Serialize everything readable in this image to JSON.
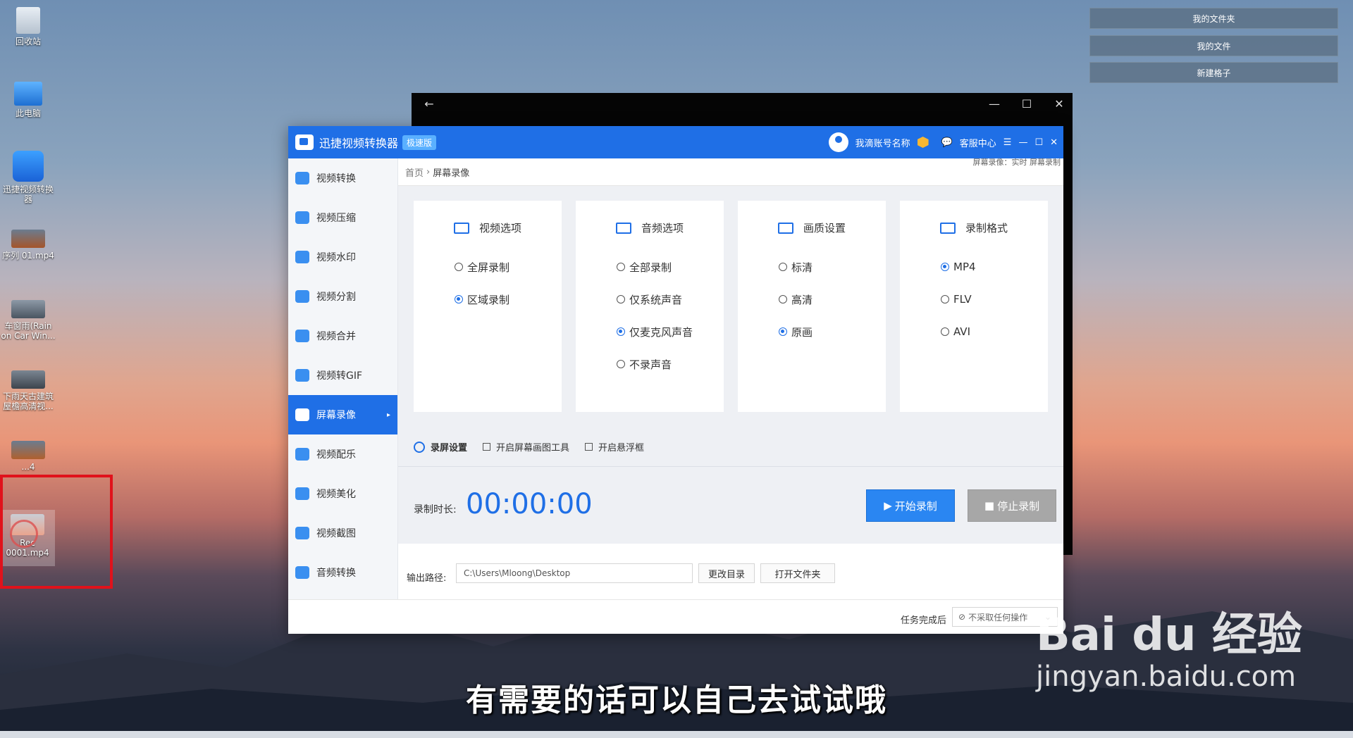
{
  "desktop": {
    "icons": [
      {
        "name": "recycle-bin",
        "label": "回收站"
      },
      {
        "name": "this-pc",
        "label": "此电脑"
      },
      {
        "name": "xunjie-shortcut",
        "label": "迅捷视频转换器"
      },
      {
        "name": "video-file-1",
        "label": "序列 01.mp4"
      },
      {
        "name": "video-file-2",
        "label": "车窗雨(Rain on Car Win..."
      },
      {
        "name": "video-file-3",
        "label": "下雨天古建筑屋檐高清视..."
      },
      {
        "name": "video-file-4",
        "label": "...4"
      },
      {
        "name": "rec-file",
        "label": "Rec 0001.mp4"
      }
    ],
    "right_buttons": [
      "我的文件夹",
      "我的文件",
      "新建格子"
    ]
  },
  "app": {
    "title": "迅捷视频转换器",
    "badge": "极速版",
    "account": "我滴账号名称",
    "service": "客服中心",
    "note": "屏幕录像：实时 屏幕录制",
    "sidebar": [
      {
        "label": "视频转换",
        "active": false
      },
      {
        "label": "视频压缩",
        "active": false
      },
      {
        "label": "视频水印",
        "active": false
      },
      {
        "label": "视频分割",
        "active": false
      },
      {
        "label": "视频合并",
        "active": false
      },
      {
        "label": "视频转GIF",
        "active": false
      },
      {
        "label": "屏幕录像",
        "active": true
      },
      {
        "label": "视频配乐",
        "active": false
      },
      {
        "label": "视频美化",
        "active": false
      },
      {
        "label": "视频截图",
        "active": false
      },
      {
        "label": "音频转换",
        "active": false
      }
    ],
    "breadcrumb": {
      "home": "首页",
      "current": "屏幕录像"
    },
    "cards": {
      "video": {
        "title": "视频选项",
        "options": [
          "全屏录制",
          "区域录制"
        ],
        "selected": 1
      },
      "audio": {
        "title": "音频选项",
        "options": [
          "全部录制",
          "仅系统声音",
          "仅麦克风声音",
          "不录声音"
        ],
        "selected": 2
      },
      "quality": {
        "title": "画质设置",
        "options": [
          "标清",
          "高清",
          "原画"
        ],
        "selected": 2
      },
      "format": {
        "title": "录制格式",
        "options": [
          "MP4",
          "FLV",
          "AVI"
        ],
        "selected": 0
      }
    },
    "settings": {
      "label": "录屏设置",
      "check1": "开启屏幕画图工具",
      "check2": "开启悬浮框"
    },
    "record": {
      "label": "录制时长:",
      "time": "00:00:00",
      "start": "开始录制",
      "stop": "停止录制"
    },
    "output": {
      "label": "输出路径:",
      "path": "C:\\Users\\Mloong\\Desktop",
      "change": "更改目录",
      "open": "打开文件夹"
    },
    "footer": {
      "label": "任务完成后",
      "select": "不采取任何操作"
    }
  },
  "overlay": {
    "subtitle": "有需要的话可以自己去试试哦",
    "watermark_big": "Bai du 经验",
    "watermark_small": "jingyan.baidu.com"
  }
}
